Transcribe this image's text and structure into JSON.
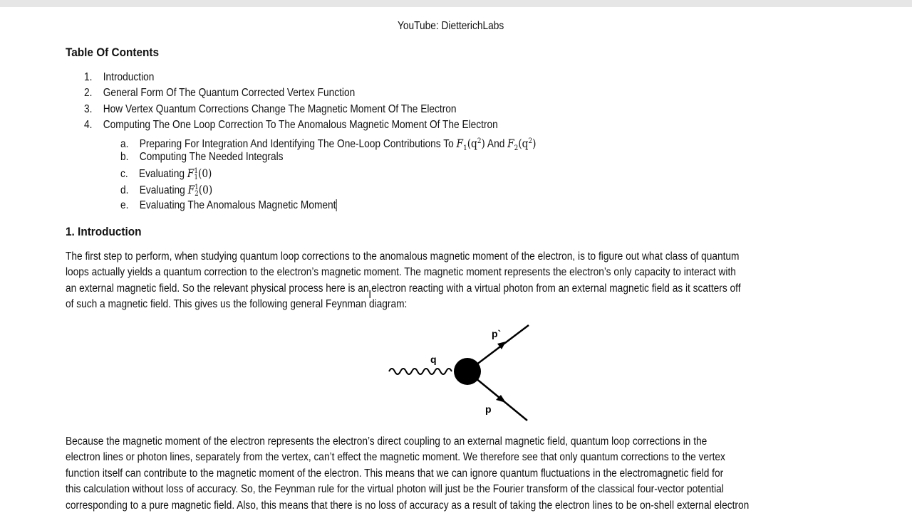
{
  "header": {
    "text": "YouTube: DietterichLabs"
  },
  "toc": {
    "title": "Table Of Contents",
    "items": [
      {
        "num": "1.",
        "label": "Introduction"
      },
      {
        "num": "2.",
        "label": "General Form Of The Quantum Corrected Vertex Function"
      },
      {
        "num": "3.",
        "label": "How Vertex Quantum Corrections Change The Magnetic Moment Of The Electron"
      },
      {
        "num": "4.",
        "label": "Computing The One Loop Correction To The Anomalous Magnetic Moment Of The Electron"
      }
    ],
    "subitems": [
      {
        "num": "a.",
        "label": "Preparing For Integration And Identifying The One-Loop Contributions To",
        "math1": "F",
        "sub1": "1",
        "arg1": "(q",
        "sup1": "2",
        "close1": ")",
        "mid": "And",
        "math2": "F",
        "sub2": "2",
        "arg2": "(q",
        "sup2": "2",
        "close2": ")"
      },
      {
        "num": "b.",
        "label": "Computing The Needed Integrals"
      },
      {
        "num": "c.",
        "label": "Evaluating",
        "math": "F",
        "sup": "1",
        "sub": "1",
        "arg": "(0)"
      },
      {
        "num": "d.",
        "label": "Evaluating",
        "math": "F",
        "sup": "1",
        "sub": "2",
        "arg": "(0)"
      },
      {
        "num": "e.",
        "label": "Evaluating The Anomalous Magnetic Moment"
      }
    ]
  },
  "section1": {
    "heading": "1. Introduction",
    "para1": [
      "The first step to perform, when studying quantum loop corrections to the anomalous magnetic moment of the electron, is to figure out what class of quantum",
      "loops actually yields a quantum correction to the electron’s magnetic moment. The magnetic moment represents the electron’s only capacity to interact with",
      "an external magnetic field. So the relevant physical process here is an electron reacting with a virtual photon from an external magnetic field as it scatters off",
      "of such a magnetic field. This gives us the following general Feynman diagram:"
    ],
    "diagram": {
      "photon_label": "q",
      "out_label": "p`",
      "in_label": "p"
    },
    "para2": [
      "Because the magnetic moment of the electron represents the electron’s direct coupling to an external magnetic field, quantum loop corrections in the",
      "electron lines or photon lines, separately from the vertex, can’t effect the magnetic moment. We therefore see that only quantum corrections to the vertex",
      "function itself can contribute to the magnetic moment of the electron. This means that we can ignore quantum fluctuations in the electromagnetic field for",
      "this calculation without loss of accuracy. So, the Feynman rule for the virtual photon will just be the Fourier transform of the classical four-vector potential",
      "corresponding to a pure magnetic field. Also, this means that there is no loss of accuracy as a result of taking the electron lines to be on-shell external electron"
    ]
  }
}
